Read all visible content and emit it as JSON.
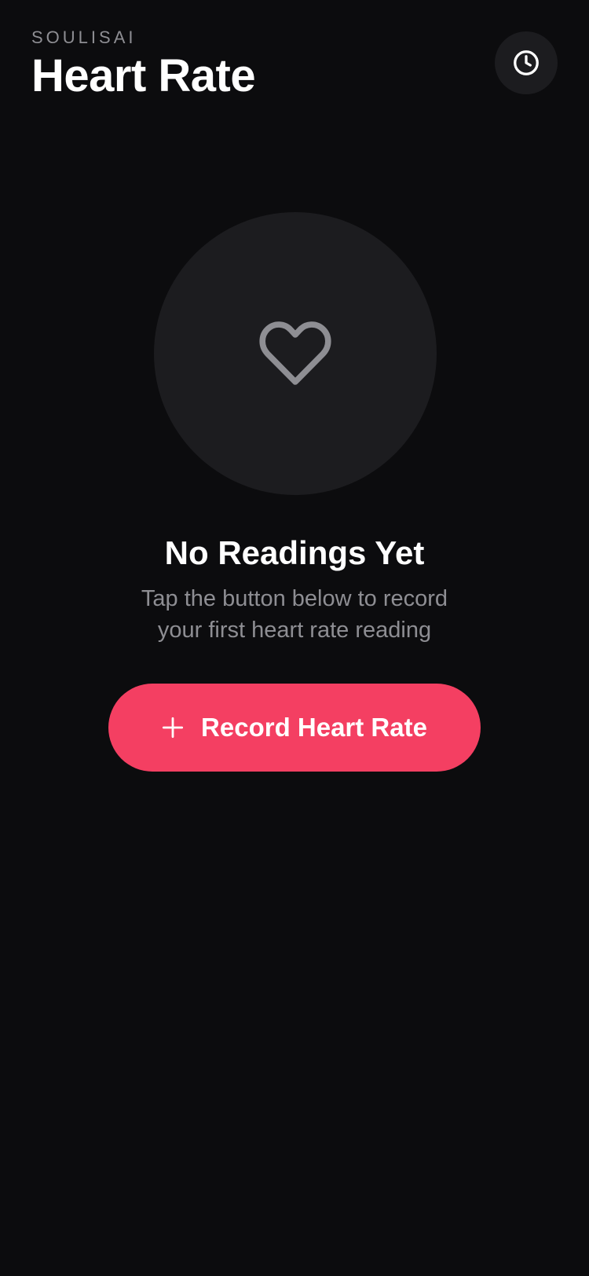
{
  "header": {
    "brand": "SOULISAI",
    "title": "Heart Rate"
  },
  "history_button": {
    "icon": "clock-icon"
  },
  "empty_state": {
    "icon": "heart-outline-icon",
    "title": "No Readings Yet",
    "subtitle_line1": "Tap the button below to record",
    "subtitle_line2": "your first heart rate reading"
  },
  "record_button": {
    "icon": "plus-icon",
    "label": "Record Heart Rate"
  },
  "colors": {
    "background": "#0c0c0e",
    "surface": "#1c1c1f",
    "accent": "#f43f62",
    "muted_text": "#8e8e93"
  }
}
